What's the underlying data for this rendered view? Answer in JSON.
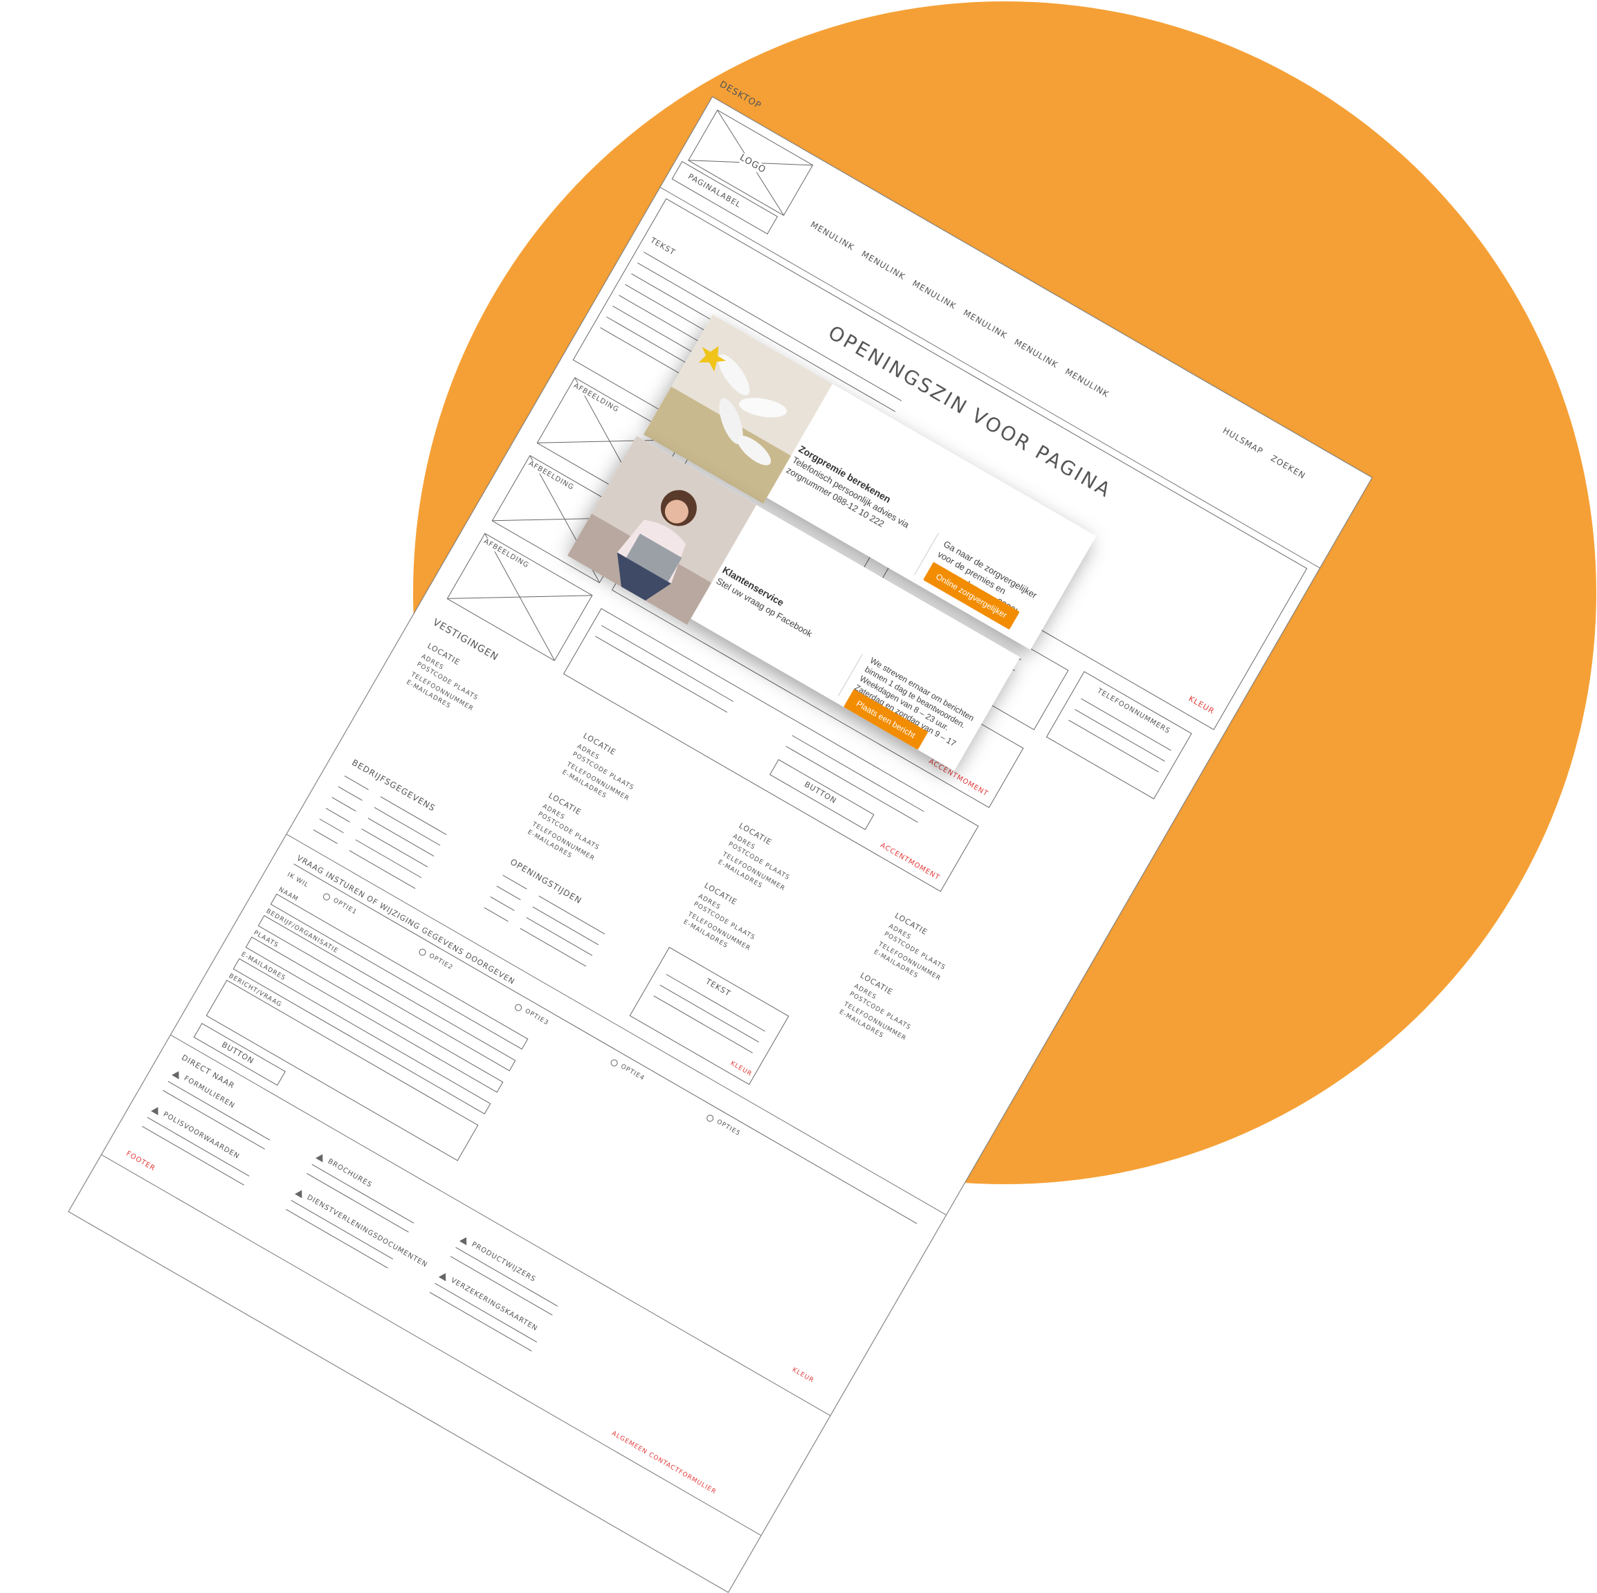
{
  "wireframe": {
    "device_label": "DESKTOP",
    "logo": "LOGO",
    "page_label": "PAGINALABEL",
    "menu_links": [
      "MENULINK",
      "MENULINK",
      "MENULINK",
      "MENULINK",
      "MENULINK",
      "MENULINK"
    ],
    "util_links": [
      "HULSMAP",
      "ZOEKEN"
    ],
    "headline": "OPENINGSZIN VOOR PAGINA",
    "text_label": "TEKST",
    "kleur": "KLEUR",
    "image_label": "AFBEELDING",
    "phone_label": "TELEFOONNUMMERS",
    "button_label": "BUTTON",
    "accent_label": "ACCENTMOMENT",
    "locations_title": "VESTIGINGEN",
    "location": {
      "title": "LOCATIE",
      "address": "ADRES",
      "postcode": "POSTCODE PLAATS",
      "phone": "TELEFOONNUMMER",
      "email": "E-MAILADRES"
    },
    "company_title": "BEDRIJFSGEGEVENS",
    "hours_title": "OPENINGSTIJDEN",
    "form_title": "VRAAG INSTUREN OF WIJZIGING GEGEVENS DOORGEVEN",
    "form_labels": [
      "IK WIL",
      "NAAM",
      "BEDRIJF/ORGANISATIE",
      "PLAATS",
      "E-MAILADRES",
      "BERICHT/VRAAG"
    ],
    "options": [
      "OPTIE1",
      "OPTIE2",
      "OPTIE3",
      "OPTIE4",
      "OPTIE5"
    ],
    "direct_title": "DIRECT NAAR",
    "direct_items": [
      "FORMULIEREN",
      "BROCHURES",
      "PRODUCTWIJZERS",
      "POLISVOORWAARDEN",
      "DIENSTVERLENINGSDOCUMENTEN",
      "VERZEKERINGSKAARTEN"
    ],
    "footer": "FOOTER",
    "footer_right": "ALGEMEEN CONTACTFORMULIER"
  },
  "cards": [
    {
      "title": "Zorgpremie berekenen",
      "subtitle": "Telefonisch persoonlijk advies via zorgnummer 088-12 10 222",
      "right_text": "Ga naar de zorgvergelijker voor de premies en voorwaarden voor 2020!",
      "button": "Online zorgvergelijker"
    },
    {
      "title": "Klantenservice",
      "subtitle": "Stel uw vraag op Facebook",
      "right_text": "We streven ernaar om berichten binnen 1 dag te beantwoorden. Weekdagen van 8 – 23 uur. Zaterdag en zondag van 9 – 17 uur.",
      "button": "Plaats een bericht"
    }
  ],
  "colors": {
    "accent_circle": "#f5a036",
    "button": "#f28c00",
    "wire_red": "#e33b3b"
  }
}
